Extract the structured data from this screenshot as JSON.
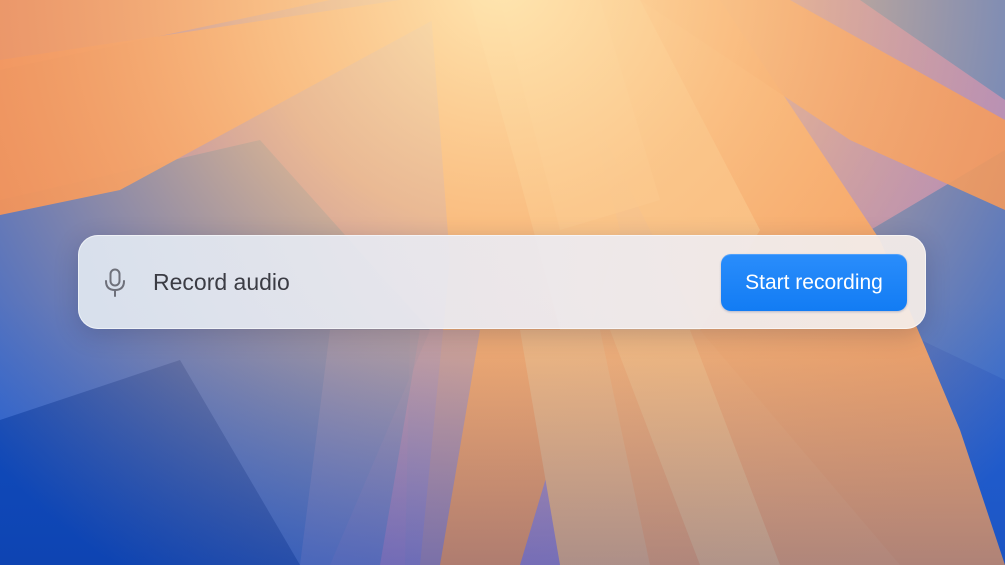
{
  "recorder": {
    "label": "Record audio",
    "start_button_label": "Start recording",
    "icon": "microphone-icon"
  },
  "colors": {
    "accent": "#1a82f7",
    "label_text": "#3b3c44",
    "icon": "#6e707a"
  }
}
